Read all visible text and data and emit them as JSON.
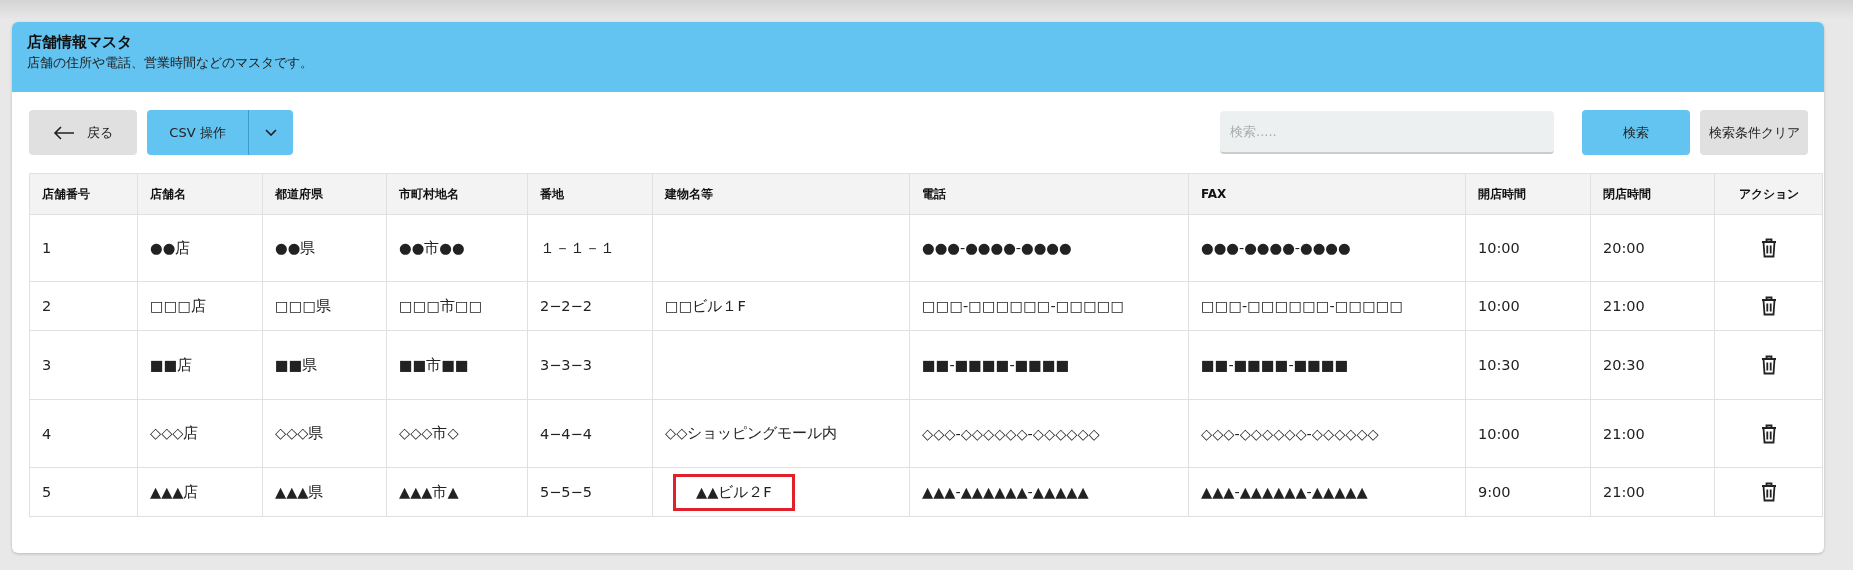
{
  "header": {
    "title": "店舗情報マスタ",
    "subtitle": "店舗の住所や電話、営業時間などのマスタです。"
  },
  "toolbar": {
    "back_button": "戻る",
    "csv_button": "CSV 操作",
    "search": {
      "placeholder": "検索....."
    },
    "search_button": "検索",
    "clear_button": "検索条件クリア"
  },
  "table": {
    "columns": [
      "店舗番号",
      "店舗名",
      "都道府県",
      "市町村地名",
      "番地",
      "建物名等",
      "電話",
      "FAX",
      "開店時間",
      "閉店時間",
      "アクション"
    ],
    "rows": [
      {
        "cells": [
          "1",
          "●●店",
          "●●県",
          "●●市●●",
          "１－１－１",
          "",
          "●●●-●●●●-●●●●",
          "●●●-●●●●-●●●●",
          "10:00",
          "20:00"
        ],
        "highlighted": false
      },
      {
        "cells": [
          "2",
          "□□□店",
          "□□□県",
          "□□□市□□",
          "2−2−2",
          "□□ビル１F",
          "□□□-□□□□□□-□□□□□",
          "□□□-□□□□□□-□□□□□",
          "10:00",
          "21:00"
        ],
        "highlighted": false
      },
      {
        "cells": [
          "3",
          "■■店",
          "■■県",
          "■■市■■",
          "3−3−3",
          "",
          "■■-■■■■-■■■■",
          "■■-■■■■-■■■■",
          "10:30",
          "20:30"
        ],
        "highlighted": false
      },
      {
        "cells": [
          "4",
          "◇◇◇店",
          "◇◇◇県",
          "◇◇◇市◇",
          "4−4−4",
          "◇◇ショッピングモール内",
          "◇◇◇-◇◇◇◇◇◇-◇◇◇◇◇◇",
          "◇◇◇-◇◇◇◇◇◇-◇◇◇◇◇◇",
          "10:00",
          "21:00"
        ],
        "highlighted": false
      },
      {
        "cells": [
          "5",
          "▲▲▲店",
          "▲▲▲県",
          "▲▲▲市▲",
          "5−5−5",
          "▲▲ビル２F",
          "▲▲▲-▲▲▲▲▲▲-▲▲▲▲▲",
          "▲▲▲-▲▲▲▲▲▲-▲▲▲▲▲",
          "9:00",
          "21:00"
        ],
        "highlighted": true
      }
    ]
  }
}
